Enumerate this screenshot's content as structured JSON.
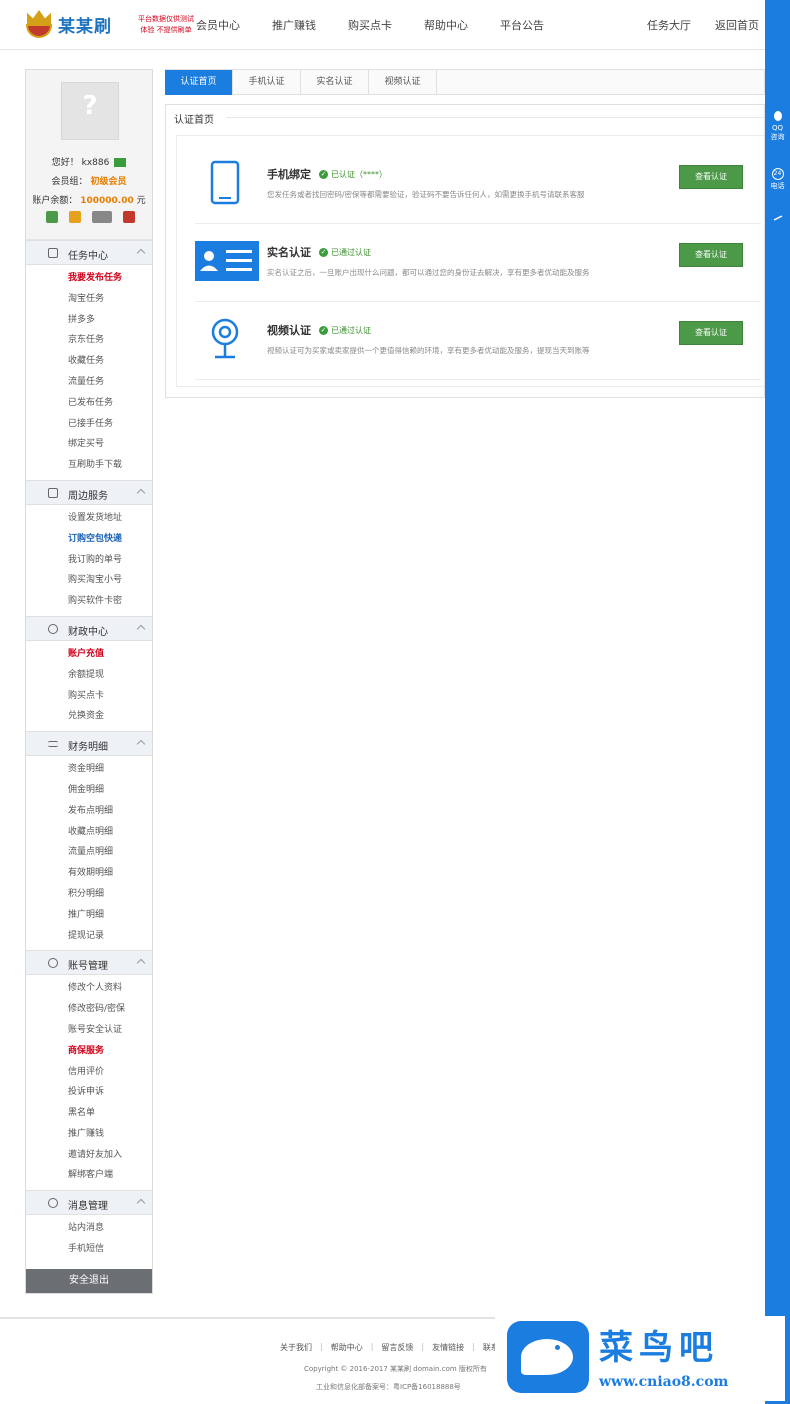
{
  "header": {
    "logo_text": "某某刷",
    "slogan_1": "平台数据仅供测试",
    "slogan_2": "体验 不提供刷单",
    "nav": [
      "会员中心",
      "推广赚钱",
      "购买点卡",
      "帮助中心",
      "平台公告"
    ],
    "nav_right": [
      "任务大厅",
      "返回首页"
    ]
  },
  "right_bar": {
    "qq_1": "QQ",
    "qq_2": "咨询",
    "phone_badge": "24",
    "phone_label": "电话"
  },
  "profile": {
    "greeting": "您好！",
    "username": "kx886",
    "level_label": "会员组：",
    "level_value": "初级会员",
    "balance_label": "账户余额：",
    "balance_value": "100000.00",
    "balance_unit": "元"
  },
  "sidebar": {
    "sections": [
      {
        "title": "任务中心",
        "items": [
          "我要发布任务",
          "淘宝任务",
          "拼多多",
          "京东任务",
          "收藏任务",
          "流量任务",
          "已发布任务",
          "已接手任务",
          "绑定买号",
          "互刷助手下载"
        ]
      },
      {
        "title": "周边服务",
        "items": [
          "设置发货地址",
          "订购空包快递",
          "我订购的单号",
          "购买淘宝小号",
          "购买软件卡密"
        ]
      },
      {
        "title": "财政中心",
        "items": [
          "账户充值",
          "余额提现",
          "购买点卡",
          "兑换资金"
        ]
      },
      {
        "title": "财务明细",
        "items": [
          "资金明细",
          "佣金明细",
          "发布点明细",
          "收藏点明细",
          "流量点明细",
          "有效期明细",
          "积分明细",
          "推广明细",
          "提现记录"
        ]
      },
      {
        "title": "账号管理",
        "items": [
          "修改个人资料",
          "修改密码/密保",
          "账号安全认证",
          "商保服务",
          "信用评价",
          "投诉申诉",
          "黑名单",
          "推广赚钱",
          "邀请好友加入",
          "解绑客户端"
        ]
      },
      {
        "title": "消息管理",
        "items": [
          "站内消息",
          "手机短信"
        ]
      }
    ],
    "logout": "安全退出"
  },
  "tabs": [
    "认证首页",
    "手机认证",
    "实名认证",
    "视频认证"
  ],
  "panel": {
    "legend": "认证首页",
    "rows": [
      {
        "title": "手机绑定",
        "status": "已认证（****）",
        "desc": "您发任务或者找回密码/密保等都需要验证，验证码不要告诉任何人，如需更换手机号请联系客服",
        "button": "查看认证"
      },
      {
        "title": "实名认证",
        "status": "已通过认证",
        "desc": "实名认证之后，一旦账户出现什么问题，都可以通过您的身份证去解决，享有更多者优动能及服务",
        "button": "查看认证"
      },
      {
        "title": "视频认证",
        "status": "已通过认证",
        "desc": "视频认证可为买家或卖家提供一个更值得信赖的环境，享有更多者优动能及服务，提现当天到账等",
        "button": "查看认证"
      }
    ]
  },
  "footer": {
    "links": [
      "关于我们",
      "帮助中心",
      "留言反馈",
      "友情链接",
      "联系我们"
    ],
    "copyright": "Copyright © 2016-2017 某某刷 domain.com 版权所有",
    "icp": "工业和信息化部备案号：粤ICP备16018888号"
  },
  "watermark": {
    "title": "菜鸟吧",
    "url": "www.cniao8.com"
  },
  "colors": {
    "brand_blue": "#1c7de0",
    "button_green": "#4c9a48",
    "highlight_red": "#d0021b",
    "level_orange": "#e67e00"
  }
}
